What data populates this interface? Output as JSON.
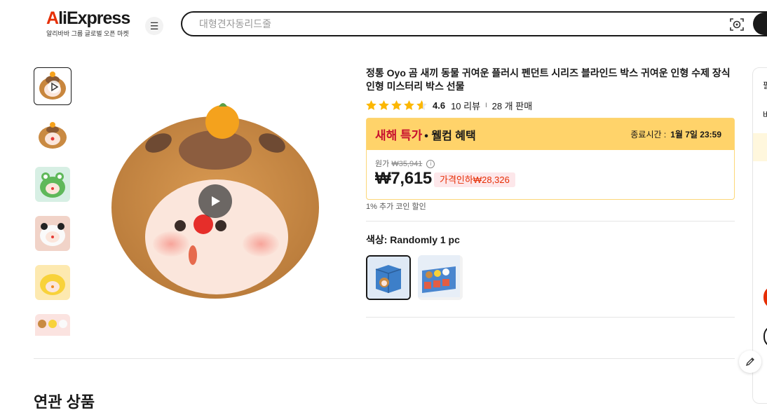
{
  "header": {
    "logo_text": "AliExpress",
    "logo_sub": "알리바바 그룹 글로벌 오픈 마켓",
    "search_placeholder": "대형견자동리드줄"
  },
  "product": {
    "title": "정통 Oyo 곰 새끼 동물 귀여운 플러시 펜던트 시리즈 블라인드 박스 귀여운 인형 수제 장식 인형 미스터리 박스 선물",
    "rating": "4.6",
    "rating_stars": 4.6,
    "reviews": "10 리뷰",
    "sold": "28 개 판매",
    "separator": "I",
    "promo_title": "새해 특가",
    "promo_sub": "• 웰컴 혜택",
    "promo_end_label": "종료시간 :",
    "promo_end_time": "1월 7일 23:59",
    "original_label": "원가",
    "original_price": "₩35,941",
    "price": "₩7,615",
    "discount": "가격인하₩28,326",
    "coin_note": "1% 추가 코인 할인",
    "color_label": "색상: Randomly 1 pc"
  },
  "section": {
    "related_title": "연관 상품"
  },
  "sidebar": {
    "partial_1": "필",
    "partial_2": "바"
  },
  "colors": {
    "brand_red": "#e62e04",
    "promo_yellow": "#ffd36a",
    "promo_title_red": "#c8102e",
    "star": "#fcb700"
  }
}
